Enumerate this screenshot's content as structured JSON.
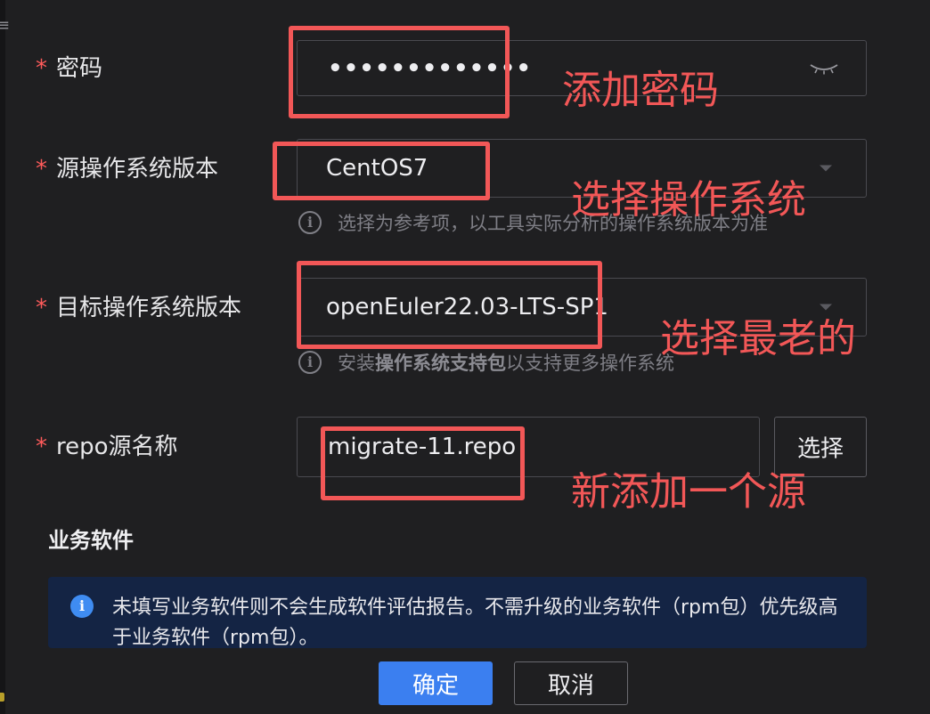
{
  "form": {
    "password": {
      "label": "密码",
      "required_mark": "*",
      "value_masked": "•••••••••••••",
      "visibility_icon": "eye-closed-icon"
    },
    "source_os": {
      "label": "源操作系统版本",
      "required_mark": "*",
      "value": "CentOS7",
      "hint": "选择为参考项，以工具实际分析的操作系统版本为准"
    },
    "target_os": {
      "label": "目标操作系统版本",
      "required_mark": "*",
      "value": "openEuler22.03-LTS-SP1",
      "hint_prefix": "安装",
      "hint_bold": "操作系统支持包",
      "hint_suffix": "以支持更多操作系统"
    },
    "repo": {
      "label": "repo源名称",
      "required_mark": "*",
      "value": "migrate-11.repo",
      "select_button": "选择"
    }
  },
  "business_software": {
    "title": "业务软件",
    "notice": "未填写业务软件则不会生成软件评估报告。不需升级的业务软件（rpm包）优先级高于业务软件（rpm包）。"
  },
  "footer": {
    "confirm": "确定",
    "cancel": "取消"
  },
  "annotations": {
    "password": "添加密码",
    "source_os": "选择操作系统",
    "target_os": "选择最老的",
    "repo": "新添加一个源",
    "color": "#f25757"
  },
  "colors": {
    "background": "#1f1f21",
    "primary": "#3b7ff0",
    "required": "#ff5b5b",
    "notice_bg": "#142444"
  }
}
